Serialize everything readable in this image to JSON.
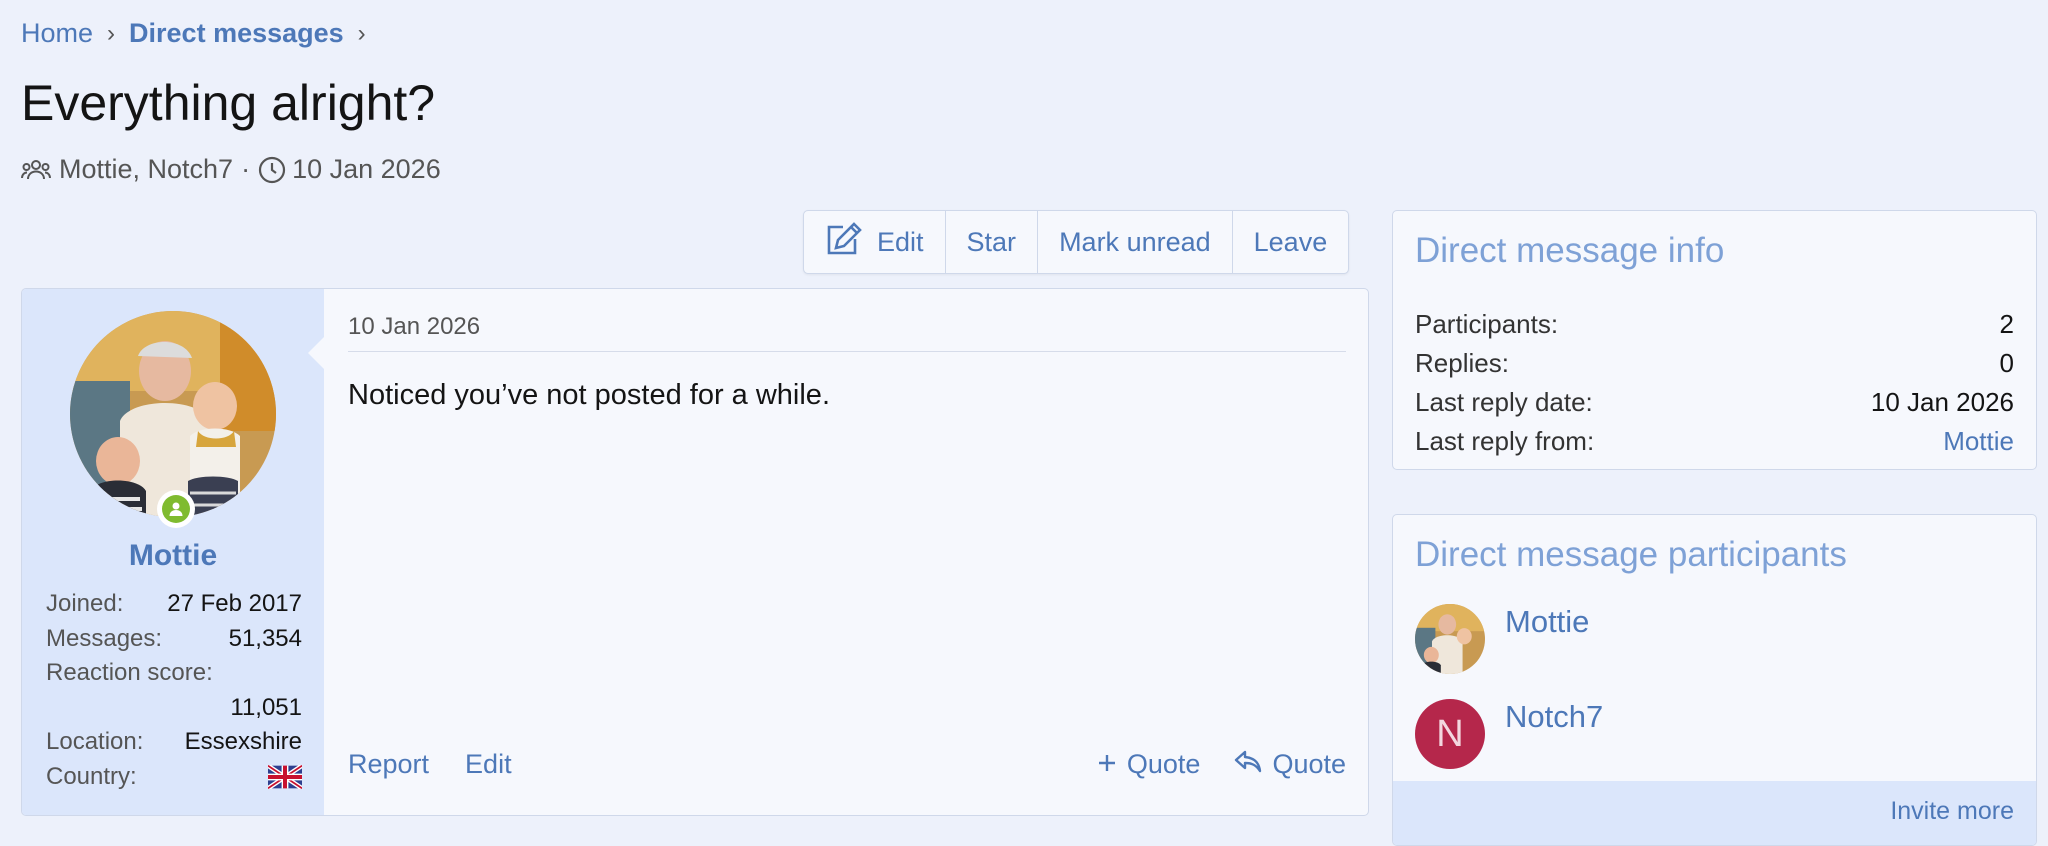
{
  "breadcrumb": {
    "home": "Home",
    "current": "Direct messages"
  },
  "title": "Everything alright?",
  "meta": {
    "participants": "Mottie, Notch7",
    "separator": "·",
    "date": "10 Jan 2026"
  },
  "actions": {
    "edit": "Edit",
    "star": "Star",
    "mark_unread": "Mark unread",
    "leave": "Leave"
  },
  "message": {
    "author": {
      "name": "Mottie",
      "online": true,
      "stats": [
        {
          "label": "Joined:",
          "value": "27 Feb 2017"
        },
        {
          "label": "Messages:",
          "value": "51,354"
        },
        {
          "label": "Reaction score:",
          "value": "11,051"
        },
        {
          "label": "Location:",
          "value": "Essexshire"
        },
        {
          "label": "Country:",
          "value": ""
        }
      ],
      "country_flag_icon": "uk-flag-icon"
    },
    "date": "10 Jan 2026",
    "body": "Noticed you’ve not posted for a while.",
    "footer": {
      "report": "Report",
      "edit": "Edit",
      "multi_quote": "Quote",
      "quote": "Quote"
    }
  },
  "info": {
    "title": "Direct message info",
    "rows": [
      {
        "label": "Participants:",
        "value": "2"
      },
      {
        "label": "Replies:",
        "value": "0"
      },
      {
        "label": "Last reply date:",
        "value": "10 Jan 2026"
      },
      {
        "label": "Last reply from:",
        "value": "Mottie"
      }
    ]
  },
  "participants": {
    "title": "Direct message participants",
    "list": [
      {
        "name": "Mottie",
        "avatar": "photo"
      },
      {
        "name": "Notch7",
        "avatar_letter": "N"
      }
    ],
    "invite_more": "Invite more"
  },
  "colors": {
    "link": "#4d78b8",
    "accent_light": "#7ea1d6",
    "user_panel": "#dbe6fb",
    "online": "#7fbb2f",
    "letter_avatar": "#b5274b"
  }
}
